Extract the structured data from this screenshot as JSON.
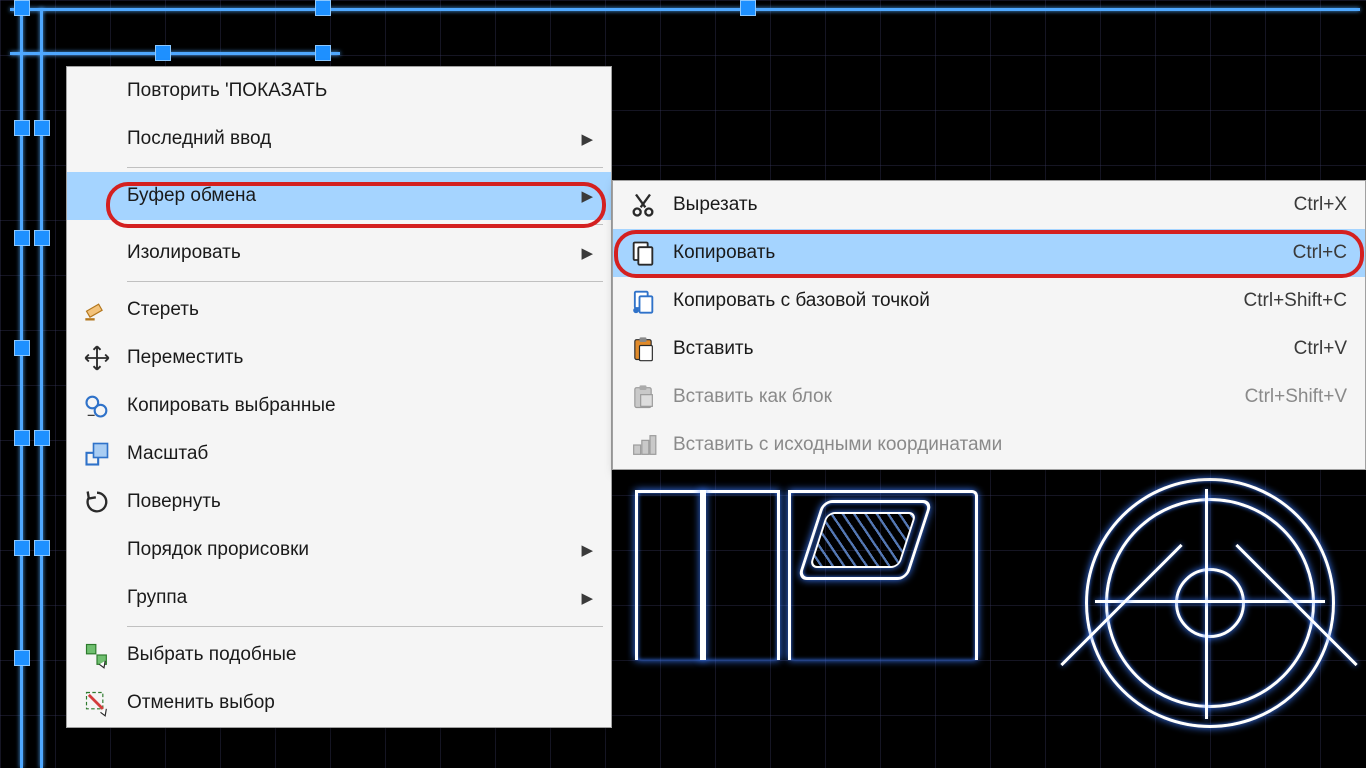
{
  "context_menu": {
    "items": [
      {
        "label": "Повторить 'ПОКАЗАТЬ"
      },
      {
        "label": "Последний ввод",
        "submenu": true
      },
      {
        "sep": true
      },
      {
        "label": "Буфер обмена",
        "submenu": true,
        "selected": true,
        "highlighted": true
      },
      {
        "sep": true
      },
      {
        "label": "Изолировать",
        "submenu": true
      },
      {
        "sep": true
      },
      {
        "label": "Стереть",
        "icon": "erase"
      },
      {
        "label": "Переместить",
        "icon": "move"
      },
      {
        "label": "Копировать выбранные",
        "icon": "copy-sel"
      },
      {
        "label": "Масштаб",
        "icon": "scale"
      },
      {
        "label": "Повернуть",
        "icon": "rotate"
      },
      {
        "label": "Порядок прорисовки",
        "submenu": true
      },
      {
        "label": "Группа",
        "submenu": true
      },
      {
        "sep": true
      },
      {
        "label": "Выбрать подобные",
        "icon": "select-similar"
      },
      {
        "label": "Отменить выбор",
        "icon": "deselect"
      }
    ]
  },
  "submenu_clipboard": {
    "items": [
      {
        "label": "Вырезать",
        "shortcut": "Ctrl+X",
        "icon": "cut"
      },
      {
        "label": "Копировать",
        "shortcut": "Ctrl+C",
        "icon": "copy",
        "selected": true,
        "highlighted": true
      },
      {
        "label": "Копировать с базовой точкой",
        "shortcut": "Ctrl+Shift+C",
        "icon": "copy-base"
      },
      {
        "label": "Вставить",
        "shortcut": "Ctrl+V",
        "icon": "paste"
      },
      {
        "label": "Вставить как блок",
        "shortcut": "Ctrl+Shift+V",
        "icon": "paste-block",
        "disabled": true
      },
      {
        "label": "Вставить с исходными координатами",
        "icon": "paste-coords",
        "disabled": true
      }
    ]
  }
}
